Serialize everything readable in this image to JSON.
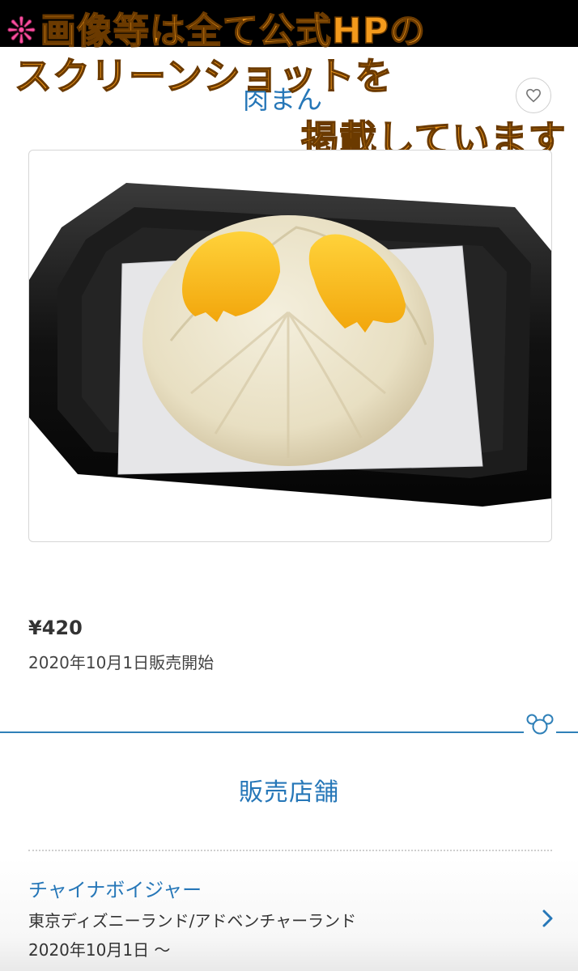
{
  "overlay": {
    "mark": "❊",
    "line1": "画像等は全て公式HPの",
    "line2": "スクリーンショットを",
    "line3": "掲載しています"
  },
  "product": {
    "title": "肉まん",
    "price": "¥420",
    "release": "2020年10月1日販売開始"
  },
  "icons": {
    "favorite": "heart-icon",
    "decoration": "mickey-icon",
    "chevron": "chevron-right-icon"
  },
  "section": {
    "title": "販売店舗"
  },
  "shops": [
    {
      "name": "チャイナボイジャー",
      "area": "東京ディズニーランド/アドベンチャーランド",
      "date": "2020年10月1日 〜"
    }
  ],
  "colors": {
    "accent": "#2677b8",
    "overlay_text": "#f39a1c",
    "overlay_mark": "#ff4fa0"
  }
}
